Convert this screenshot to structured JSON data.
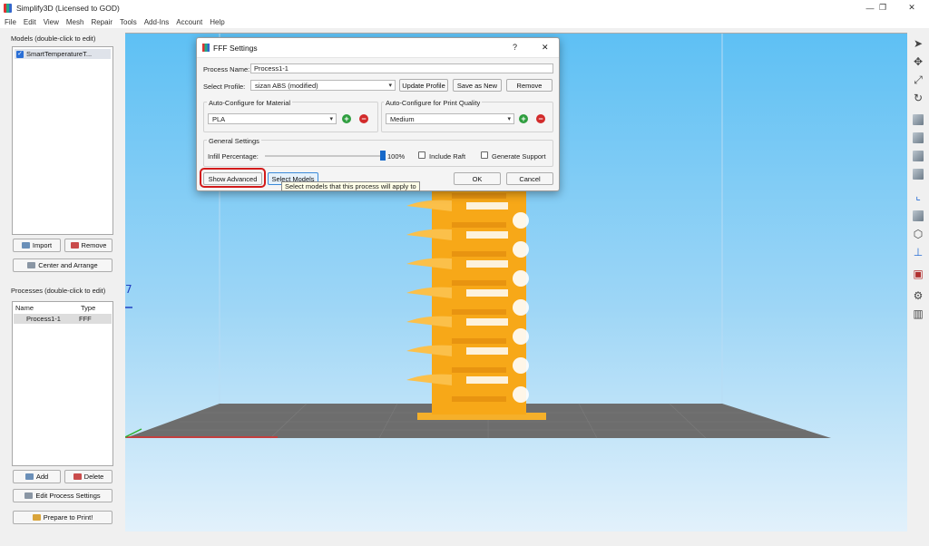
{
  "window": {
    "title": "Simplify3D (Licensed to GOD)",
    "minimize": "—",
    "restore": "❐",
    "close": "✕"
  },
  "menu": [
    "File",
    "Edit",
    "View",
    "Mesh",
    "Repair",
    "Tools",
    "Add-Ins",
    "Account",
    "Help"
  ],
  "models_panel": {
    "label": "Models (double-click to edit)",
    "items": [
      {
        "name": "SmartTemperatureT...",
        "checked": true
      }
    ],
    "import_label": "Import",
    "remove_label": "Remove",
    "center_label": "Center and Arrange"
  },
  "processes_panel": {
    "label": "Processes (double-click to edit)",
    "columns": [
      "Name",
      "Type"
    ],
    "rows": [
      {
        "name": "Process1-1",
        "type": "FFF"
      }
    ],
    "add_label": "Add",
    "delete_label": "Delete",
    "edit_label": "Edit Process Settings",
    "prepare_label": "Prepare to Print!"
  },
  "viewport": {
    "axis_mark": "7"
  },
  "dialog": {
    "title": "FFF Settings",
    "help": "?",
    "close": "✕",
    "process_name_label": "Process Name:",
    "process_name_value": "Process1-1",
    "select_profile_label": "Select Profile:",
    "profile_value": "sizan ABS  (modified)",
    "update_profile": "Update Profile",
    "save_as_new": "Save as New",
    "remove": "Remove",
    "material_group": "Auto-Configure for Material",
    "material_value": "PLA",
    "quality_group": "Auto-Configure for Print Quality",
    "quality_value": "Medium",
    "general_group": "General Settings",
    "infill_label": "Infill Percentage:",
    "infill_percent": 100,
    "infill_text": "100%",
    "include_raft": "Include Raft",
    "generate_support": "Generate Support",
    "show_advanced": "Show Advanced",
    "select_models": "Select Models",
    "ok": "OK",
    "cancel": "Cancel",
    "tooltip": "Select models that this process will apply to"
  },
  "colors": {
    "model": "#f7a818",
    "bed": "#6d6d6d",
    "accent": "#1769c9",
    "highlight": "#d21b1b"
  }
}
